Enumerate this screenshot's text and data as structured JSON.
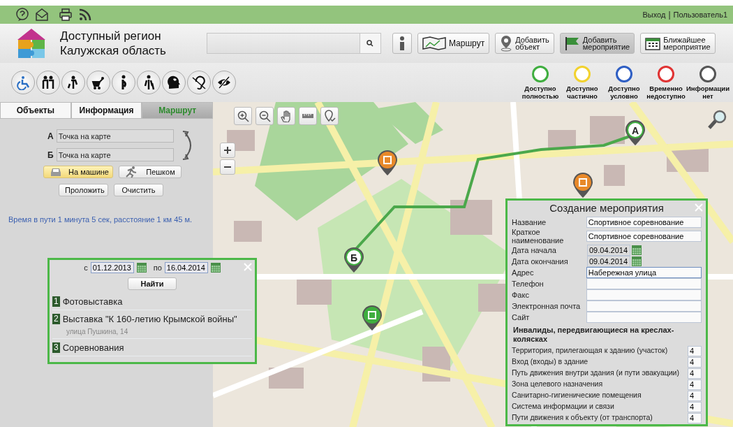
{
  "top_bar": {
    "logout": "Выход",
    "separator": "|",
    "user": "Пользователь1"
  },
  "header": {
    "title_lines": [
      "Доступный регион",
      "Калужская область"
    ],
    "buttons": [
      {
        "kind": "info",
        "selected": false
      },
      {
        "kind": "route",
        "lines": [
          "Маршрут"
        ],
        "selected": false
      },
      {
        "kind": "add-object",
        "lines": [
          "Добавить",
          "объект"
        ],
        "selected": false
      },
      {
        "kind": "add-event",
        "lines": [
          "Добавить",
          "мероприятие"
        ],
        "selected": true
      },
      {
        "kind": "nearest",
        "lines": [
          "Ближайшее",
          "мероприятие"
        ],
        "selected": false
      }
    ]
  },
  "filters": [
    {
      "kind": "wheelchair"
    },
    {
      "kind": "elderly"
    },
    {
      "kind": "children"
    },
    {
      "kind": "stroller"
    },
    {
      "kind": "pregnant"
    },
    {
      "kind": "blind"
    },
    {
      "kind": "mental"
    },
    {
      "kind": "deaf"
    },
    {
      "kind": "vision"
    }
  ],
  "legend": [
    {
      "lines": [
        "Доступно",
        "полностью"
      ],
      "color": "#3fae3f"
    },
    {
      "lines": [
        "Доступно",
        "частично"
      ],
      "color": "#f2d22e"
    },
    {
      "lines": [
        "Доступно",
        "условно"
      ],
      "color": "#2f5fc4"
    },
    {
      "lines": [
        "Временно",
        "недоступно"
      ],
      "color": "#e03434"
    },
    {
      "lines": [
        "Информации",
        "нет"
      ],
      "color": "#555555"
    }
  ],
  "sidebar": {
    "tabs": [
      {
        "label": "Объекты",
        "selected": false
      },
      {
        "label": "Информация",
        "selected": false
      },
      {
        "label": "Маршрут",
        "selected": true
      }
    ],
    "route": {
      "points": [
        {
          "letter": "А",
          "value": "Точка на карте"
        },
        {
          "letter": "Б",
          "value": "Точка на карте"
        }
      ],
      "modes": [
        {
          "kind": "car",
          "label": "На машине",
          "selected": true
        },
        {
          "kind": "walk",
          "label": "Пешком",
          "selected": false
        }
      ],
      "actions": [
        "Проложить",
        "Очистить"
      ],
      "summary": "Время в пути 1 минута 5 сек, расстояние 1 км 45 м."
    }
  },
  "map": {
    "pins": [
      {
        "kind": "letter",
        "letter": "А"
      },
      {
        "kind": "letter",
        "letter": "Б"
      },
      {
        "kind": "museum"
      },
      {
        "kind": "event"
      },
      {
        "kind": "photo"
      }
    ]
  },
  "events_popup": {
    "from_label": "с",
    "from": "01.12.2013",
    "to_label": "по",
    "to": "16.04.2014",
    "search_button": "Найти",
    "results": [
      {
        "number": "1",
        "title": "Фотовыставка"
      },
      {
        "number": "2",
        "title": "Выставка \"К 160-летию Крымской войны\"",
        "address": "улица Пушкина, 14"
      },
      {
        "number": "3",
        "title": "Соревнования"
      }
    ]
  },
  "event_form": {
    "title": "Создание мероприятия",
    "fields": [
      {
        "kind": "text",
        "label": "Название",
        "value": "Спортивное соревнование"
      },
      {
        "kind": "text",
        "label": "Краткое наименование",
        "value": "Спортивное соревнование"
      },
      {
        "kind": "date",
        "label": "Дата начала",
        "value": "09.04.2014"
      },
      {
        "kind": "date",
        "label": "Дата окончания",
        "value": "09.04.2014"
      },
      {
        "kind": "text",
        "label": "Адрес",
        "value": "Набережная улица",
        "focused": true
      },
      {
        "kind": "text",
        "label": "Телефон"
      },
      {
        "kind": "text",
        "label": "Факс"
      },
      {
        "kind": "text",
        "label": "Электронная почта"
      },
      {
        "kind": "text",
        "label": "Сайт"
      }
    ],
    "section": "Инвалиды, передвигающиеся на креслах-колясках",
    "ratings": [
      {
        "label": "Территория, прилегающая к зданию (участок)",
        "value": "4"
      },
      {
        "label": "Вход (входы) в здание",
        "value": "4"
      },
      {
        "label": "Путь движения внутри здания (и пути эвакуации)",
        "value": "4"
      },
      {
        "label": "Зона целевого назначения",
        "value": "4"
      },
      {
        "label": "Санитарно-гигиенические помещения",
        "value": "4"
      },
      {
        "label": "Система информации и связи",
        "value": "4"
      },
      {
        "label": "Пути движения к объекту (от транспорта)",
        "value": "4"
      }
    ]
  }
}
